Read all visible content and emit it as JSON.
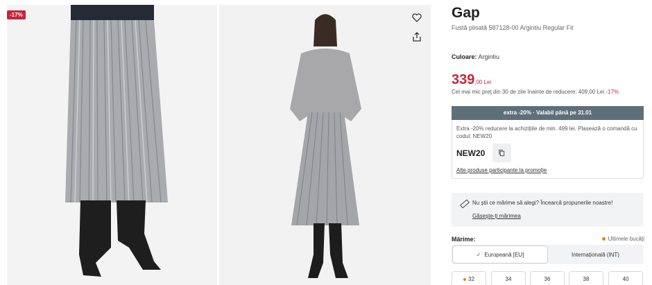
{
  "gallery": {
    "badge": "-17%",
    "icons": {
      "favorite": "heart-icon",
      "share": "share-icon"
    }
  },
  "product": {
    "brand": "Gap",
    "title": "Fustă plisată 587128-00 Argintiu Regular Fit",
    "color_label": "Culoare:",
    "color_value": "Argintiu",
    "price_int": "339",
    "price_dec": ",00",
    "currency": "Lei",
    "lowest_price_text": "Cel mai mic preț din 30 de zile înainte de reducere: 409,00 Lei",
    "lowest_price_pct": "-17%"
  },
  "promo": {
    "header": "extra -20% · Valabil până pe 31.01",
    "description": "Extra -20% reducere la achizițiile de min. 499 lei. Plasează o comandă cu codul: NEW20",
    "code": "NEW20",
    "link": "Alte produse participante la promoție"
  },
  "size_help": {
    "text": "Nu știi ce mărime să alegi? Încearcă propunerile noastre!",
    "link": "Găsește-ți mărimea"
  },
  "sizes": {
    "label": "Mărime:",
    "stock_note": "Ultimele bucăți",
    "tab_eu": "Europeană [EU]",
    "tab_int": "Internațională (INT)",
    "options": [
      "32",
      "34",
      "36",
      "38",
      "40"
    ]
  },
  "colors": {
    "accent_red": "#c8243a",
    "promo_header_bg": "#5e6f77",
    "stock_dot": "#d8891c"
  }
}
